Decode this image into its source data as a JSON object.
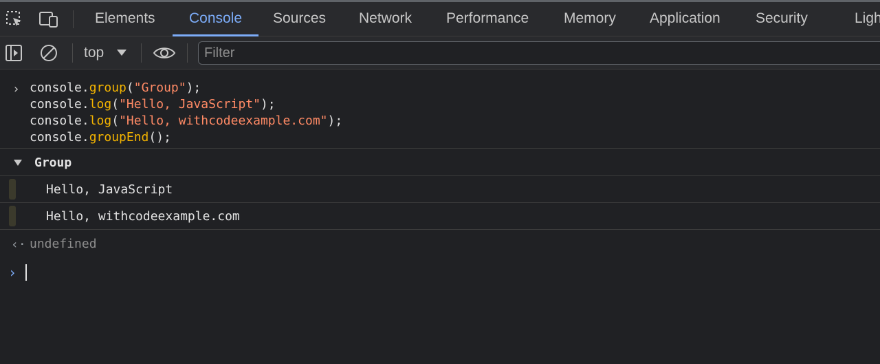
{
  "tabs": [
    {
      "label": "Elements",
      "active": false
    },
    {
      "label": "Console",
      "active": true
    },
    {
      "label": "Sources",
      "active": false
    },
    {
      "label": "Network",
      "active": false
    },
    {
      "label": "Performance",
      "active": false
    },
    {
      "label": "Memory",
      "active": false
    },
    {
      "label": "Application",
      "active": false
    },
    {
      "label": "Security",
      "active": false
    },
    {
      "label": "Ligh",
      "active": false
    }
  ],
  "toolbar": {
    "context": "top",
    "filter_placeholder": "Filter",
    "icons": [
      "sidebar-toggle-icon",
      "clear-console-icon",
      "context-dropdown-icon",
      "live-expression-eye-icon"
    ]
  },
  "tabbar_icons": [
    "inspect-element-icon",
    "device-toolbar-icon"
  ],
  "console": {
    "input_lines": [
      {
        "obj": "console.",
        "fn": "group",
        "open": "(",
        "str": "\"Group\"",
        "close": ");"
      },
      {
        "obj": "console.",
        "fn": "log",
        "open": "(",
        "str": "\"Hello, JavaScript\"",
        "close": ");"
      },
      {
        "obj": "console.",
        "fn": "log",
        "open": "(",
        "str": "\"Hello, withcodeexample.com\"",
        "close": ");"
      },
      {
        "obj": "console.",
        "fn": "groupEnd",
        "open": "();",
        "str": "",
        "close": ""
      }
    ],
    "group_label": "Group",
    "messages": [
      "Hello, JavaScript",
      "Hello, withcodeexample.com"
    ],
    "result": "undefined"
  },
  "colors": {
    "background": "#202124",
    "toolbar": "#292a2d",
    "accent": "#7cacf8",
    "function": "#f4b400",
    "string": "#ff8a65"
  }
}
